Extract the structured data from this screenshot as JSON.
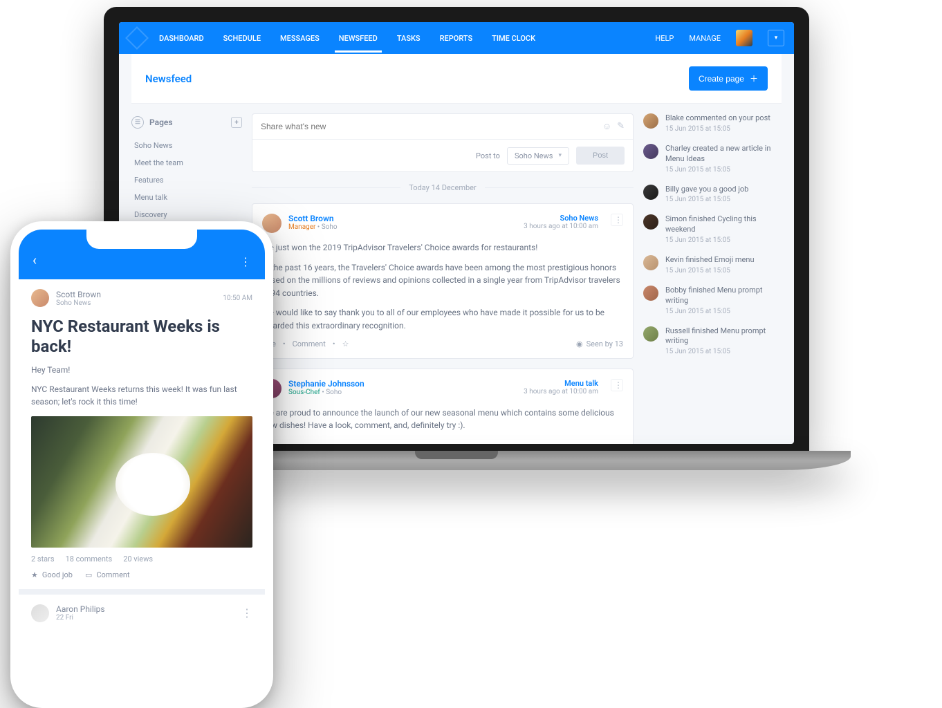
{
  "nav": {
    "items": [
      "DASHBOARD",
      "SCHEDULE",
      "MESSAGES",
      "NEWSFEED",
      "TASKS",
      "REPORTS",
      "TIME CLOCK"
    ],
    "active_index": 3,
    "right": {
      "help": "HELP",
      "manage": "MANAGE"
    }
  },
  "subheader": {
    "title": "Newsfeed",
    "create_btn": "Create page"
  },
  "sidebar": {
    "title": "Pages",
    "items": [
      "Soho News",
      "Meet the team",
      "Features",
      "Menu talk",
      "Discovery"
    ]
  },
  "composer": {
    "placeholder": "Share what's new",
    "post_to_label": "Post to",
    "post_to_value": "Soho News",
    "post_btn": "Post"
  },
  "date_divider": "Today 14 December",
  "posts": [
    {
      "author": "Scott Brown",
      "role_prefix": "Manager",
      "role_suffix": " • Soho",
      "channel": "Soho News",
      "time": "3 hours ago at 10:00 am",
      "avatar_class": "a1",
      "role_class": "orange",
      "paragraphs": [
        "We just won the 2019 TripAdvisor Travelers' Choice awards for restaurants!",
        "In the past 16 years, the Travelers' Choice awards have been among the most prestigious honors based on the millions of reviews and opinions collected in a single year from TripAdvisor travelers in 94 countries.",
        "We would like to say thank you to all of our employees who have made it possible for us to be awarded this extraordinary recognition."
      ],
      "like": "Like",
      "comment": "Comment",
      "seen": "Seen by 13"
    },
    {
      "author": "Stephanie Johnsson",
      "role_prefix": "Sous-Chef",
      "role_suffix": " • Soho",
      "channel": "Menu talk",
      "time": "3 hours ago at 10:00 am",
      "avatar_class": "a2",
      "role_class": "teal",
      "paragraphs": [
        "We are proud to announce the launch of our new seasonal menu which contains some delicious new dishes! Have a look, comment, and, definitely try :)."
      ]
    }
  ],
  "activity": [
    {
      "text": "Blake commented on your post",
      "time": "15 Jun 2015 at 15:05"
    },
    {
      "text": "Charley created a new article in Menu Ideas",
      "time": "15 Jun 2015 at 15:05"
    },
    {
      "text": "Billy gave you a good job",
      "time": "15 Jun 2015 at 15:05"
    },
    {
      "text": "Simon finished Cycling this weekend",
      "time": "15 Jun 2015 at 15:05"
    },
    {
      "text": "Kevin finished Emoji menu",
      "time": "15 Jun 2015 at 15:05"
    },
    {
      "text": "Bobby finished Menu prompt writing",
      "time": "15 Jun 2015 at 15:05"
    },
    {
      "text": "Russell finished Menu prompt writing",
      "time": "15 Jun 2015 at 15:05"
    }
  ],
  "mobile": {
    "author": "Scott Brown",
    "channel": "Soho News",
    "time": "10:50 AM",
    "title": "NYC Restaurant Weeks is back!",
    "greeting": "Hey Team!",
    "body": "NYC Restaurant Weeks returns this week! It was fun last season; let's rock it this time!",
    "stats": {
      "stars": "2 stars",
      "comments": "18 comments",
      "views": "20 views"
    },
    "actions": {
      "goodjob": "Good job",
      "comment": "Comment"
    },
    "post2": {
      "author": "Aaron Philips",
      "date": "22 Fri"
    }
  }
}
